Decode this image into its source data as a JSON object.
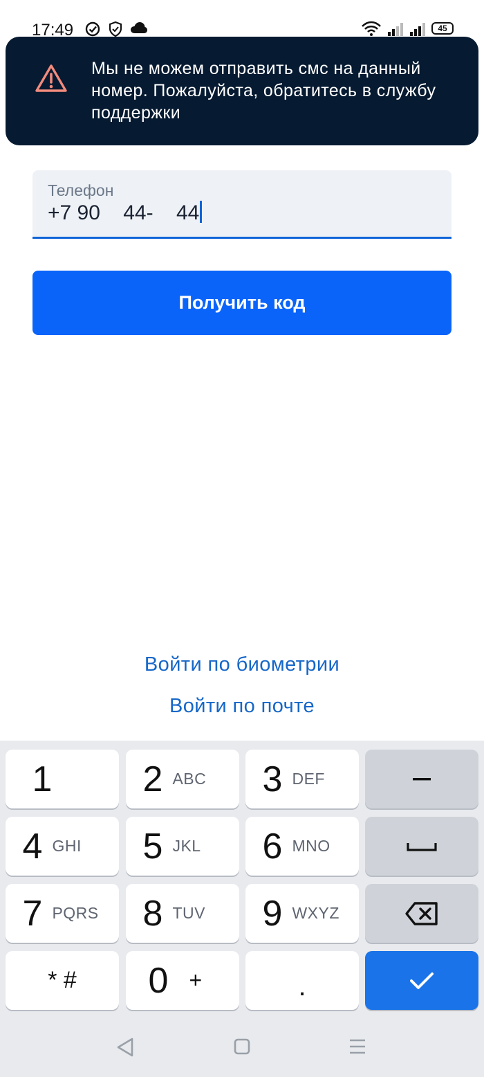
{
  "status_bar": {
    "time": "17:49",
    "battery": "45"
  },
  "notification": {
    "message": "Мы не можем отправить смс на данный номер. Пожалуйста, обратитесь в службу поддержки",
    "icon": "warning-icon",
    "icon_color": "#f28b7d",
    "background": "#061a31"
  },
  "phone_field": {
    "label": "Телефон",
    "value": "+7 90    44-    44"
  },
  "primary_button": {
    "label": "Получить код",
    "color": "#0a64fa"
  },
  "links": {
    "biometrics": "Войти по биометрии",
    "email": "Войти по почте"
  },
  "keyboard": {
    "keys": [
      {
        "main": "1",
        "sub": ""
      },
      {
        "main": "2",
        "sub": "ABC"
      },
      {
        "main": "3",
        "sub": "DEF"
      },
      {
        "main": "4",
        "sub": "GHI"
      },
      {
        "main": "5",
        "sub": "JKL"
      },
      {
        "main": "6",
        "sub": "MNO"
      },
      {
        "main": "7",
        "sub": "PQRS"
      },
      {
        "main": "8",
        "sub": "TUV"
      },
      {
        "main": "9",
        "sub": "WXYZ"
      },
      {
        "main": "* #",
        "sub": ""
      },
      {
        "main": "0",
        "sub": "+"
      },
      {
        "main": ".",
        "sub": ""
      }
    ],
    "func_keys": [
      "minus-key",
      "space-key",
      "backspace-icon",
      "checkmark-icon"
    ],
    "enter_color": "#1a73e8"
  },
  "nav_bar": {
    "icons": [
      "back-triangle-icon",
      "home-square-icon",
      "menu-lines-icon"
    ]
  }
}
